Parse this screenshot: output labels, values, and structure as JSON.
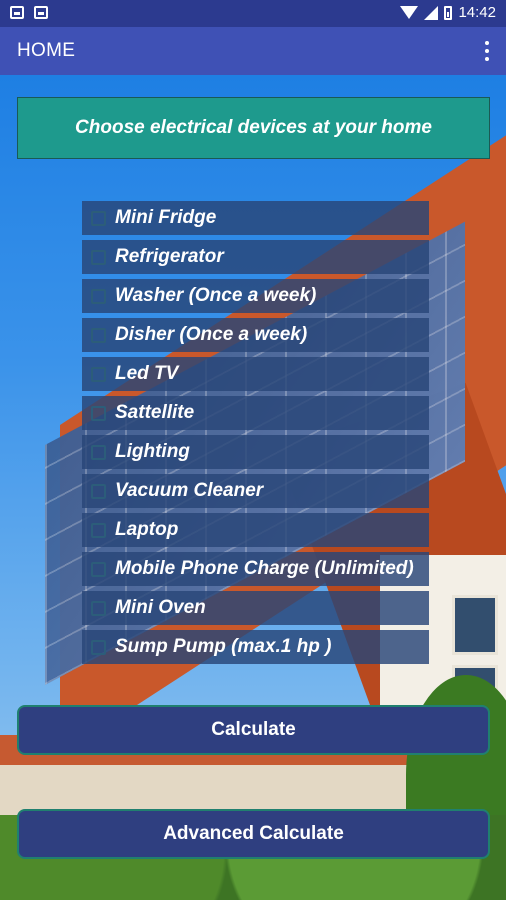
{
  "status_bar": {
    "time": "14:42",
    "icons": [
      "image-icon",
      "notification-icon",
      "wifi-icon",
      "signal-icon",
      "battery-icon"
    ]
  },
  "app_bar": {
    "title": "HOME",
    "menu_icon": "overflow-menu-icon"
  },
  "header": {
    "text": "Choose electrical devices at your home"
  },
  "devices": [
    {
      "label": "Mini Fridge",
      "checked": false
    },
    {
      "label": "Refrigerator",
      "checked": false
    },
    {
      "label": "Washer (Once a week)",
      "checked": false
    },
    {
      "label": "Disher (Once a week)",
      "checked": false
    },
    {
      "label": "Led TV",
      "checked": false
    },
    {
      "label": "Sattellite",
      "checked": false
    },
    {
      "label": "Lighting",
      "checked": false
    },
    {
      "label": "Vacuum Cleaner",
      "checked": false
    },
    {
      "label": "Laptop",
      "checked": false
    },
    {
      "label": "Mobile Phone Charge (Unlimited)",
      "checked": false
    },
    {
      "label": "Mini Oven",
      "checked": false
    },
    {
      "label": "Sump Pump (max.1 hp )",
      "checked": false
    }
  ],
  "buttons": {
    "calculate": "Calculate",
    "advanced_calculate": "Advanced Calculate"
  },
  "colors": {
    "status_bar": "#2c3a8f",
    "app_bar": "#3f51b5",
    "header_card": "#1e9a8d",
    "device_row": "#28467a",
    "button": "#2f3f80"
  }
}
